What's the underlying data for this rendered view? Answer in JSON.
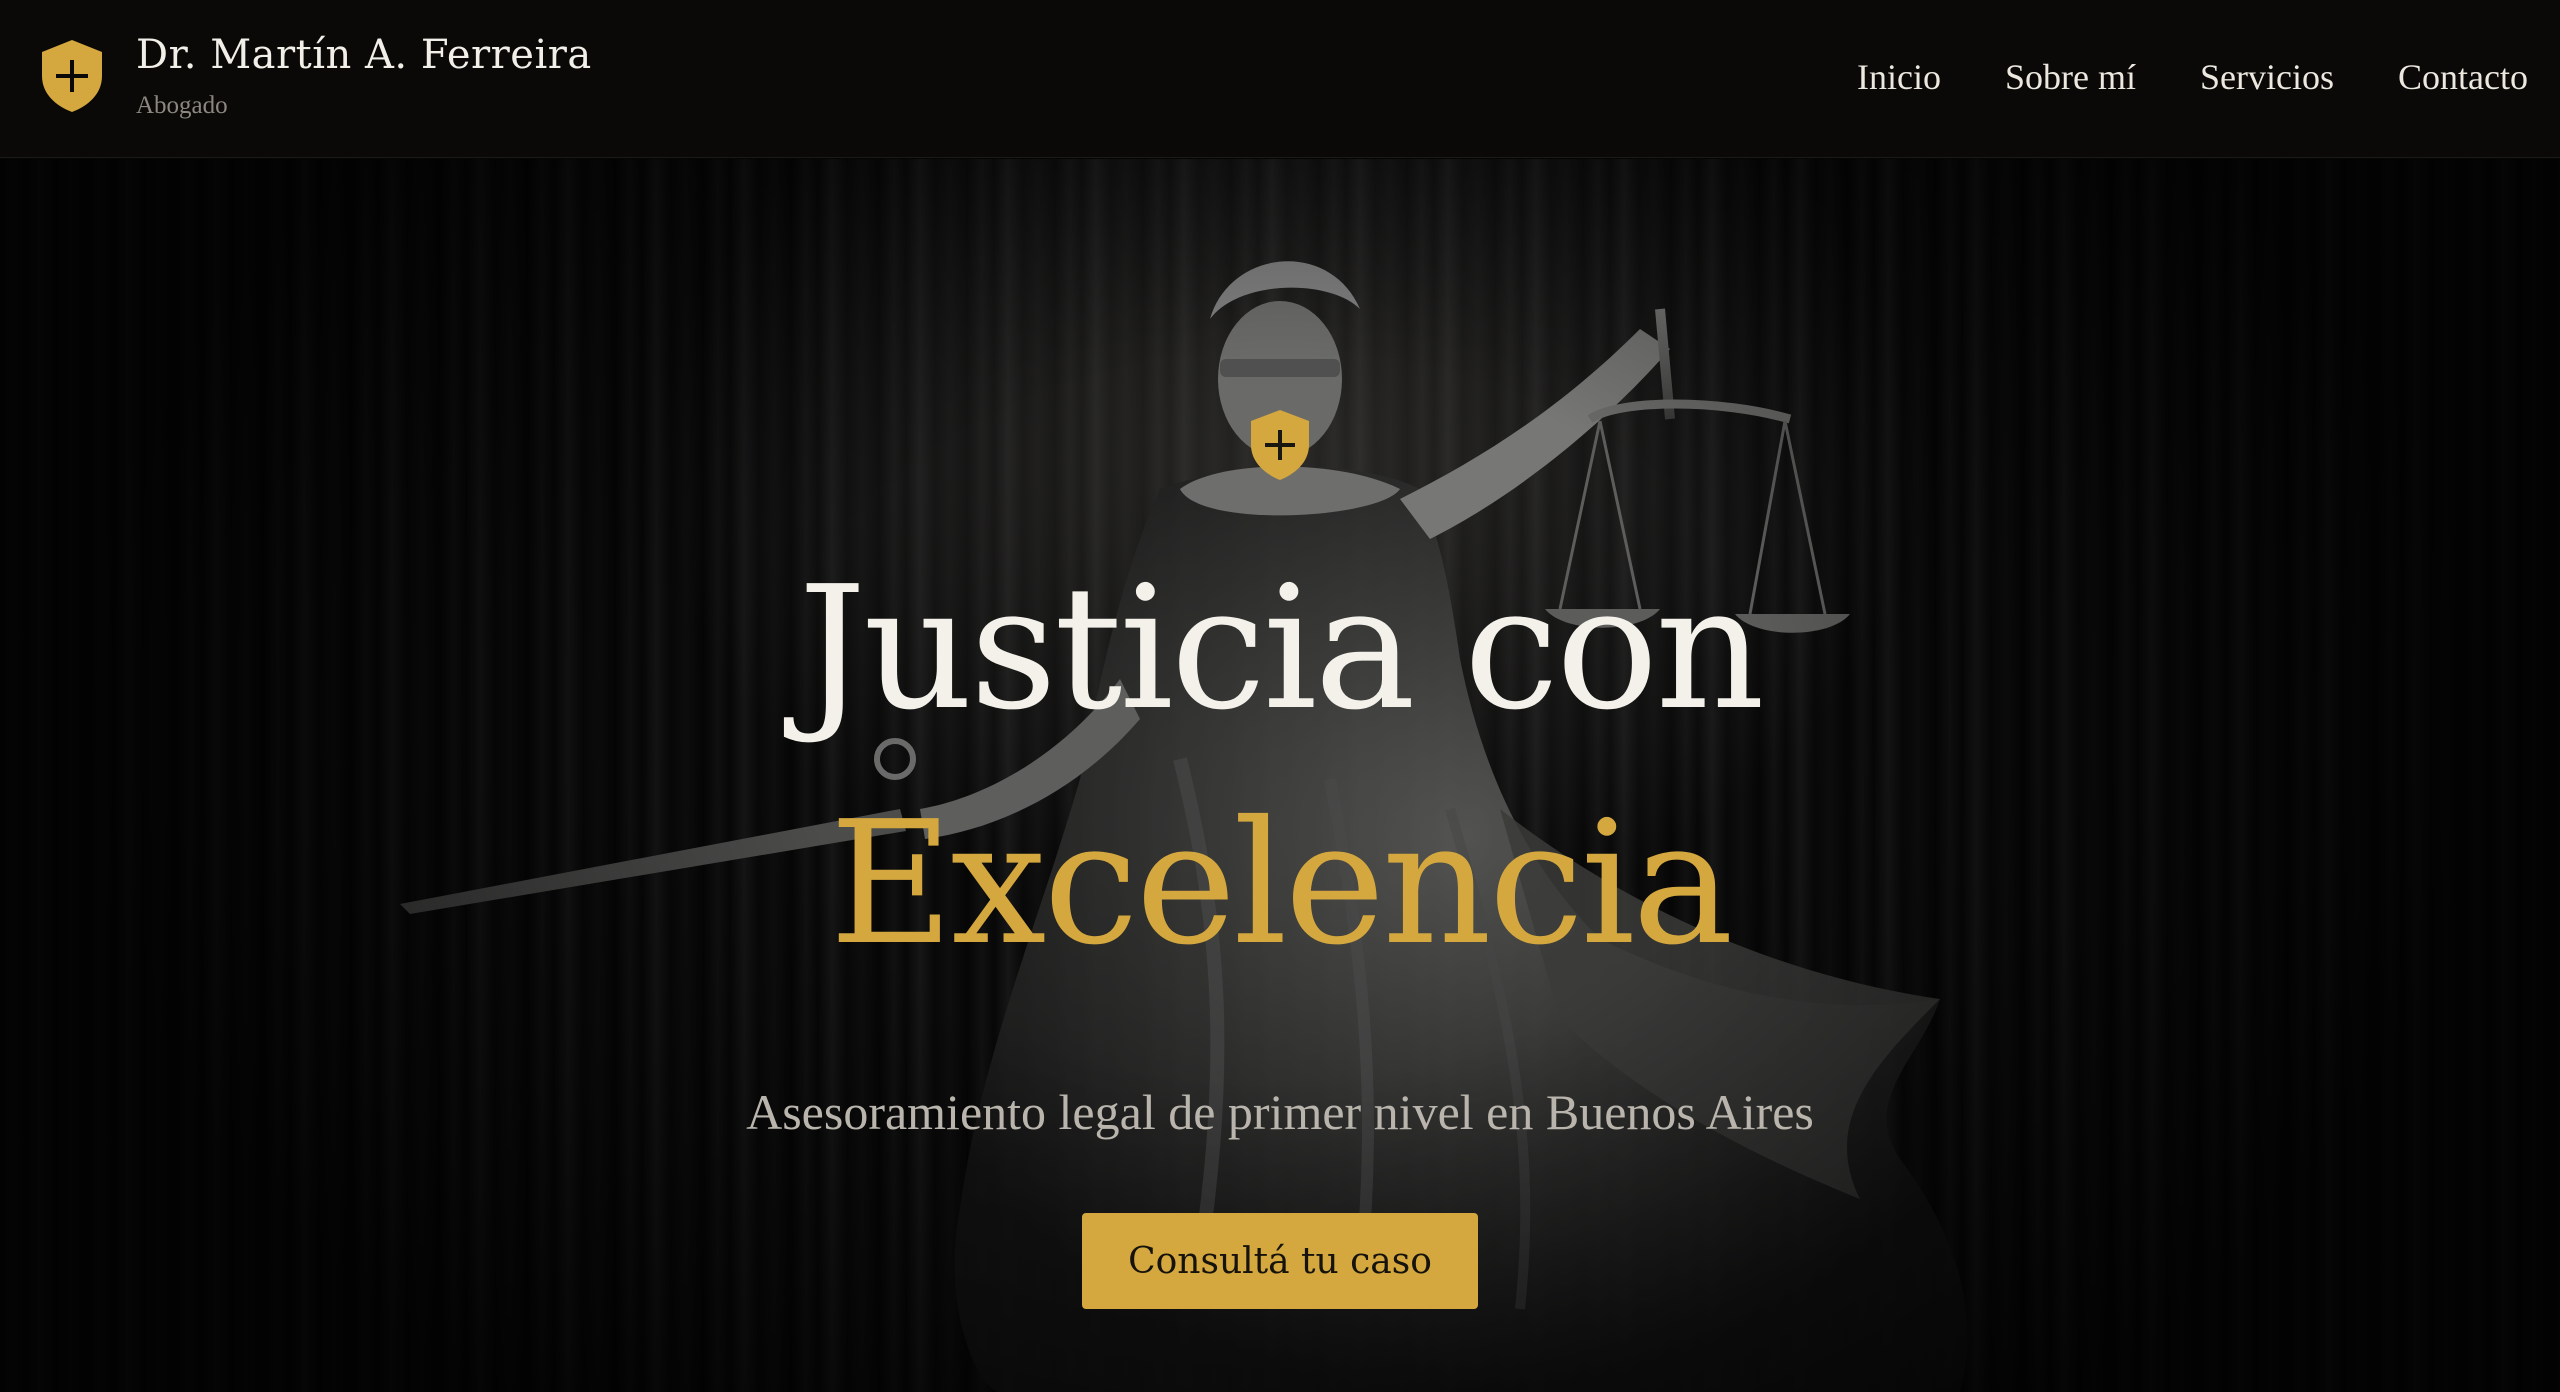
{
  "brand": {
    "name": "Dr. Martín A. Ferreira",
    "subtitle": "Abogado",
    "logo_icon": "shield-plus-icon"
  },
  "nav": {
    "items": [
      {
        "label": "Inicio"
      },
      {
        "label": "Sobre mí"
      },
      {
        "label": "Servicios"
      },
      {
        "label": "Contacto"
      }
    ]
  },
  "hero": {
    "emblem_icon": "shield-plus-icon",
    "title_line1": "Justicia con",
    "title_line2": "Excelencia",
    "subtitle": "Asesoramiento legal de primer nivel en Buenos Aires",
    "cta_label": "Consultá tu caso",
    "background": "lady-justice-statue"
  },
  "colors": {
    "accent": "#d4a83e",
    "background": "#050505",
    "header": "#0a0907",
    "text": "#f4f1ea",
    "muted": "#b9b5ad"
  }
}
